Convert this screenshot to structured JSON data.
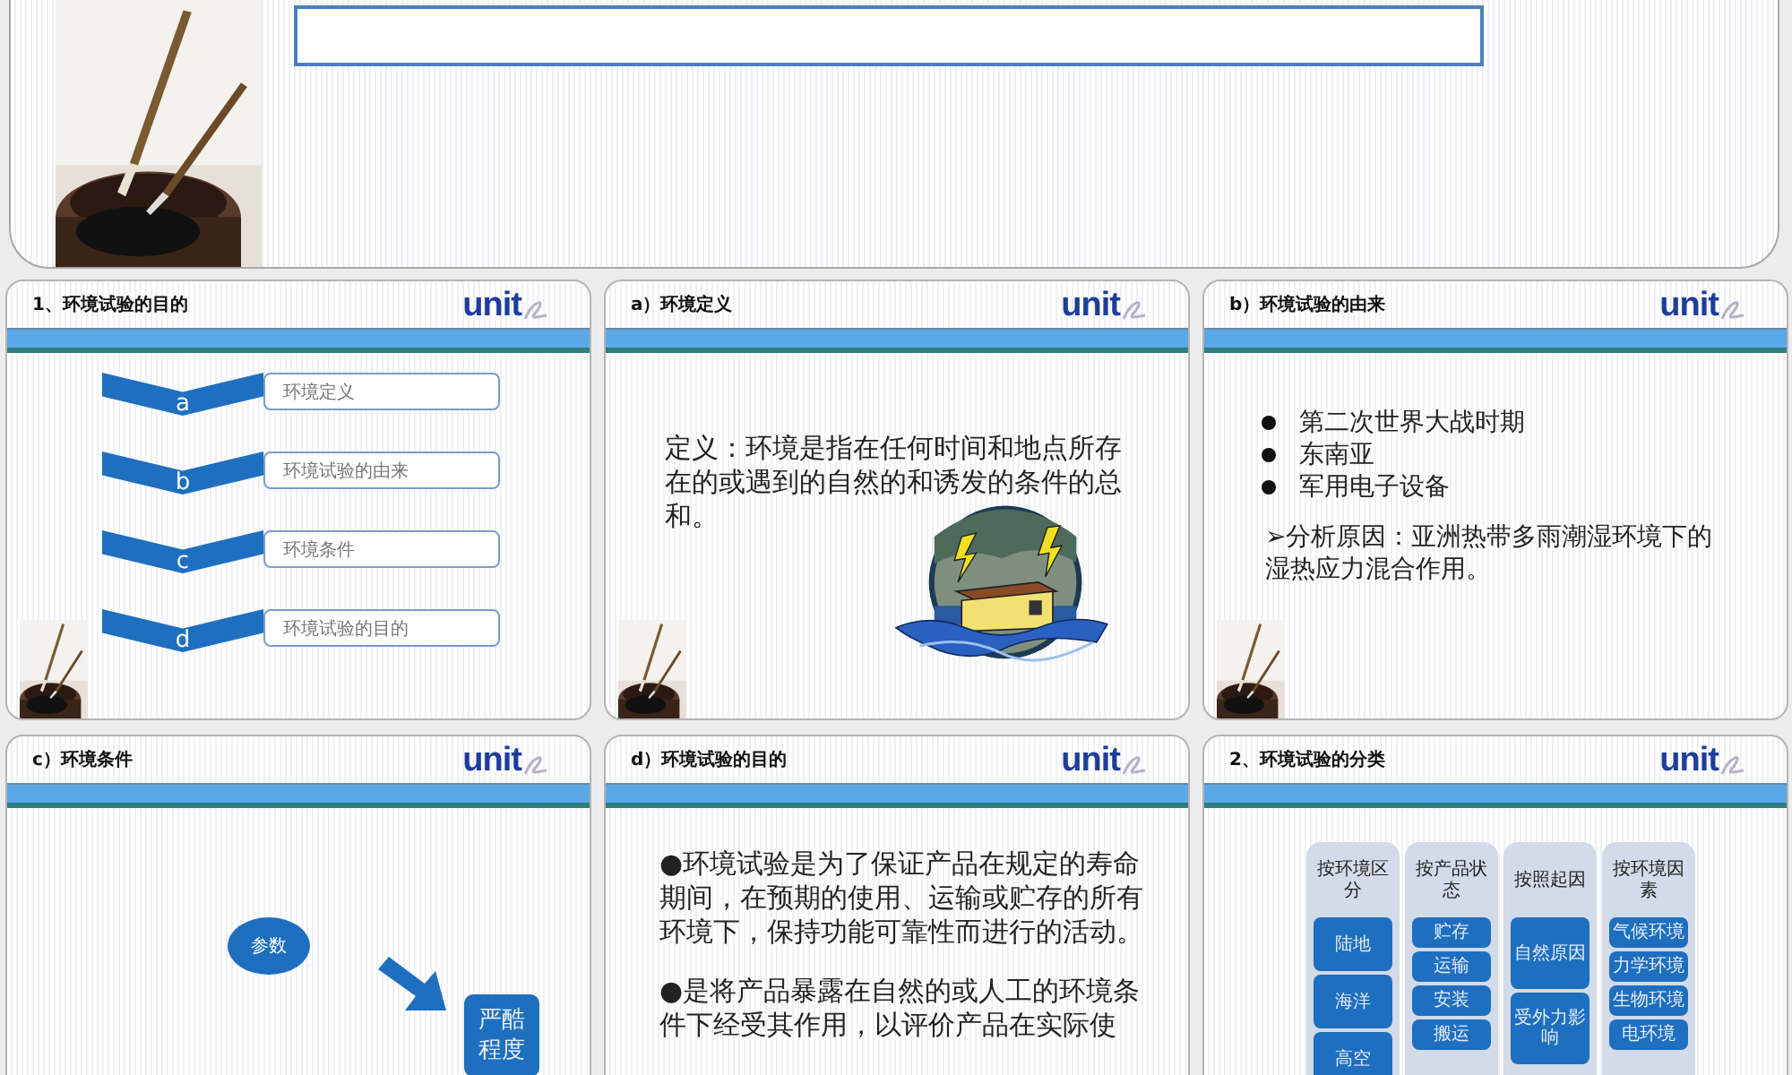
{
  "slides": [
    {
      "kind": "chevrons",
      "title": "1、环境试验的目的",
      "logo": "unit",
      "corner_picture": true,
      "items": [
        {
          "letter": "a",
          "text": "环境定义"
        },
        {
          "letter": "b",
          "text": "环境试验的由来"
        },
        {
          "letter": "c",
          "text": "环境条件"
        },
        {
          "letter": "d",
          "text": "环境试验的目的"
        }
      ]
    },
    {
      "kind": "definition",
      "title": "a）环境定义",
      "logo": "unit",
      "corner_picture": true,
      "body": "定义：环境是指在任何时间和地点所存在的或遇到的自然的和诱发的条件的总和。"
    },
    {
      "kind": "bullets",
      "title": "b）环境试验的由来",
      "logo": "unit",
      "corner_picture": true,
      "bullets": [
        "第二次世界大战时期",
        "东南亚",
        "军用电子设备"
      ],
      "note": "➢分析原因：亚洲热带多雨潮湿环境下的湿热应力混合作用。"
    },
    {
      "kind": "diagram",
      "title": "c）环境条件",
      "logo": "unit",
      "ellipse": "参数",
      "box": "严酷程度"
    },
    {
      "kind": "paragraphs",
      "title": "d）环境试验的目的",
      "logo": "unit",
      "paragraphs": [
        "●环境试验是为了保证产品在规定的寿命期间，在预期的使用、运输或贮存的所有环境下，保持功能可靠性而进行的活动。",
        "●是将产品暴露在自然的或人工的环境条件下经受其作用，以评价产品在实际使"
      ]
    },
    {
      "kind": "columns",
      "title": "2、环境试验的分类",
      "logo": "unit",
      "columns": [
        {
          "header": "按环境区分",
          "kind": "large",
          "items": [
            "陆地",
            "海洋",
            "高空"
          ]
        },
        {
          "header": "按产品状态",
          "kind": "small",
          "items": [
            "贮存",
            "运输",
            "安装",
            "搬运"
          ]
        },
        {
          "header": "按照起因",
          "kind": "xlarge",
          "items": [
            "自然原因",
            "受外力影响"
          ]
        },
        {
          "header": "按环境因素",
          "kind": "small",
          "items": [
            "气候环境",
            "力学环境",
            "生物环境",
            "电环境"
          ]
        }
      ]
    }
  ]
}
